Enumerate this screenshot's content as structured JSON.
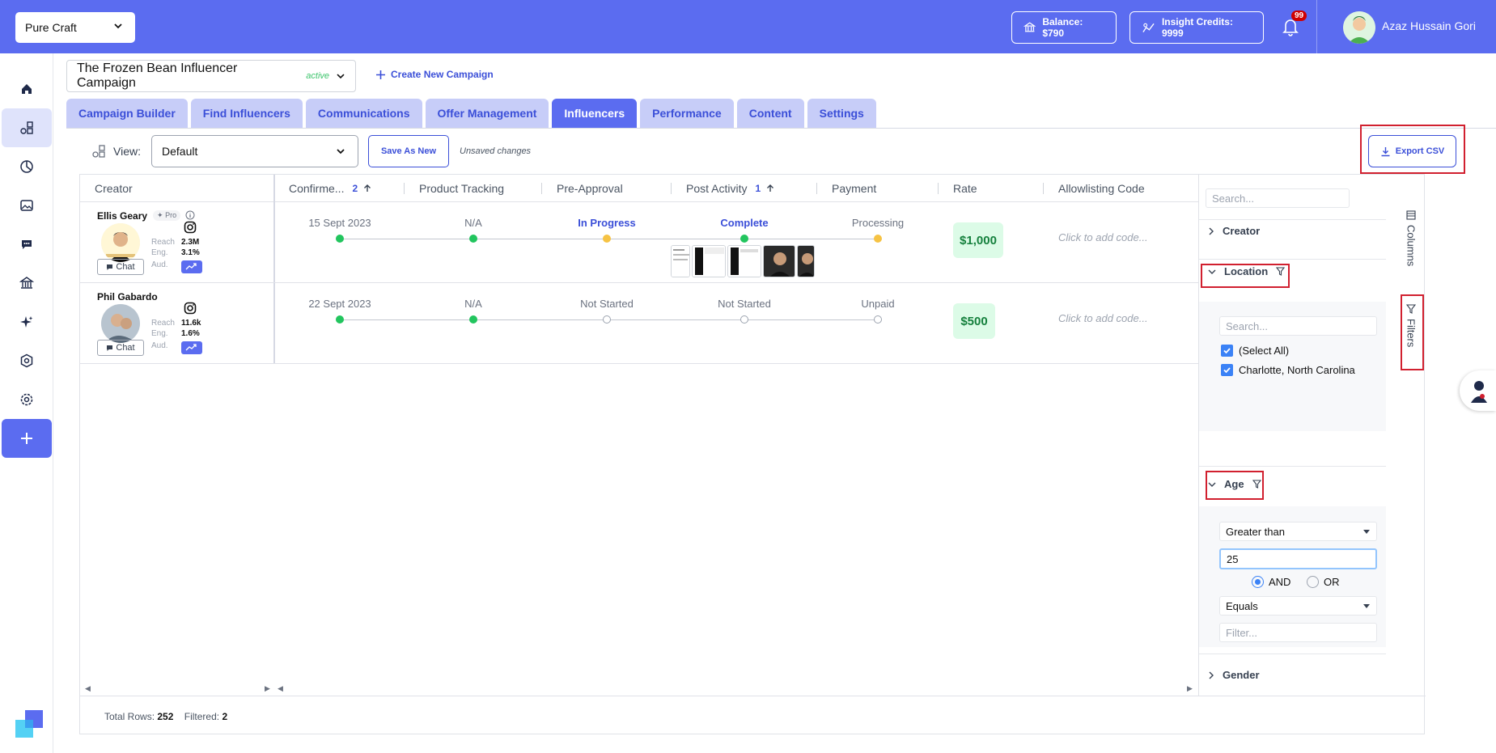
{
  "topbar": {
    "org": "Pure Craft",
    "balance": "Balance: $790",
    "insight_credits": "Insight Credits: 9999",
    "notifications_count": "99",
    "user_name": "Azaz Hussain Gori"
  },
  "campaign": {
    "title": "The Frozen Bean Influencer Campaign",
    "status": "active",
    "create_new": "Create New Campaign"
  },
  "tabs": [
    {
      "label": "Campaign Builder"
    },
    {
      "label": "Find Influencers"
    },
    {
      "label": "Communications"
    },
    {
      "label": "Offer Management"
    },
    {
      "label": "Influencers"
    },
    {
      "label": "Performance"
    },
    {
      "label": "Content"
    },
    {
      "label": "Settings"
    }
  ],
  "toolbar": {
    "view_label": "View:",
    "view_value": "Default",
    "save_as_new": "Save As New",
    "unsaved": "Unsaved changes",
    "export_csv": "Export CSV"
  },
  "grid": {
    "headers": {
      "creator": "Creator",
      "confirmed": "Confirme...",
      "confirmed_sort": "2",
      "product_tracking": "Product Tracking",
      "pre_approval": "Pre-Approval",
      "post_activity": "Post Activity",
      "post_activity_sort": "1",
      "payment": "Payment",
      "rate": "Rate",
      "allowlisting": "Allowlisting Code"
    },
    "stat_labels": {
      "reach": "Reach",
      "eng": "Eng.",
      "aud": "Aud.",
      "chat": "Chat",
      "pro": "Pro"
    },
    "rows": [
      {
        "name": "Ellis Geary",
        "reach": "2.3M",
        "eng": "3.1%",
        "confirmed": "15 Sept 2023",
        "product_tracking": "N/A",
        "pre_approval": "In Progress",
        "post_activity": "Complete",
        "payment": "Processing",
        "rate": "$1,000",
        "allowlisting": "Click to add code..."
      },
      {
        "name": "Phil Gabardo",
        "reach": "11.6k",
        "eng": "1.6%",
        "confirmed": "22 Sept 2023",
        "product_tracking": "N/A",
        "pre_approval": "Not Started",
        "post_activity": "Not Started",
        "payment": "Unpaid",
        "rate": "$500",
        "allowlisting": "Click to add code..."
      }
    ],
    "footer": {
      "total_label": "Total Rows:",
      "total": "252",
      "filtered_label": "Filtered:",
      "filtered": "2"
    }
  },
  "filters": {
    "search_placeholder": "Search...",
    "creator": "Creator",
    "location": "Location",
    "location_search": "Search...",
    "select_all": "(Select All)",
    "location_value": "Charlotte, North Carolina",
    "age": "Age",
    "age_op1": "Greater than",
    "age_value1": "25",
    "and_label": "AND",
    "or_label": "OR",
    "age_op2": "Equals",
    "age_filter_placeholder": "Filter...",
    "gender": "Gender",
    "columns_tab": "Columns",
    "filters_tab": "Filters"
  },
  "colors": {
    "primary": "#5b6cf0",
    "accent_blue": "#3b4fd8",
    "success": "#22c55e",
    "warning": "#f6c344",
    "highlight": "#d1202f"
  }
}
